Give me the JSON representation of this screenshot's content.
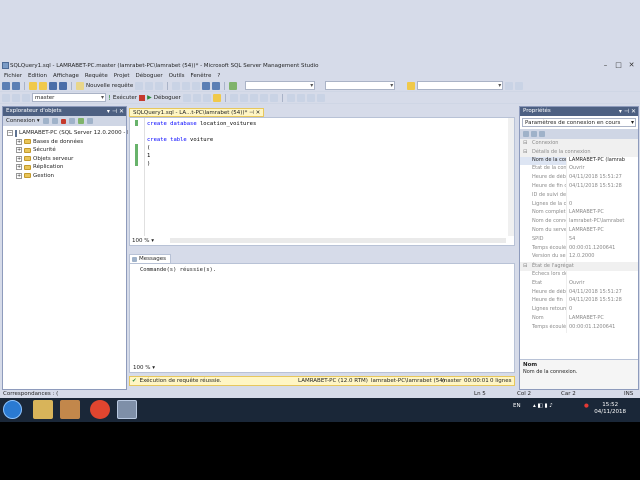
{
  "window": {
    "title": "SQLQuery1.sql - LAMRABET-PC.master (lamrabet-PC\\lamrabet (54))* - Microsoft SQL Server Management Studio"
  },
  "menu": [
    "Fichier",
    "Edition",
    "Affichage",
    "Requête",
    "Projet",
    "Déboguer",
    "Outils",
    "Fenêtre",
    "?"
  ],
  "toolbar1": {
    "new_query": "Nouvelle requête"
  },
  "toolbar2": {
    "database": "master",
    "execute": "Exécuter",
    "debug": "Déboguer"
  },
  "object_explorer": {
    "title": "Explorateur d'objets",
    "connect": "Connexion",
    "server": "LAMRABET-PC (SQL Server 12.0.2000 - la",
    "nodes": [
      "Bases de données",
      "Sécurité",
      "Objets serveur",
      "Réplication",
      "Gestion"
    ]
  },
  "document_tab": "SQLQuery1.sql - LA...t-PC\\lamrabet (54))*",
  "editor": {
    "line1_kw": "create database",
    "line1_rest": " location_voitures",
    "line3_kw": "create table",
    "line3_rest": " voiture",
    "line4": "(",
    "line5": "1",
    "line6": ")",
    "zoom": "100 %"
  },
  "results": {
    "tab": "Messages",
    "message": "Commande(s) réussie(s).",
    "zoom": "100 %"
  },
  "query_status": {
    "text": "Exécution de requête réussie.",
    "server": "LAMRABET-PC (12.0 RTM)",
    "user": "lamrabet-PC\\lamrabet (54)",
    "db": "master",
    "time": "00:00:01",
    "rows": "0 lignes"
  },
  "properties": {
    "title": "Propriétés",
    "selector": "Paramètres de connexion en cours",
    "cat1": "Connexion",
    "sub1": "Détails de la connexion",
    "rows1": [
      [
        "Nom de la connex",
        "LAMRABET-PC (lamrab"
      ],
      [
        "État de la connexi",
        "Ouvrir"
      ],
      [
        "Heure de début d",
        "04/11/2018 15:51:27"
      ],
      [
        "Heure de fin de la",
        "04/11/2018 15:51:28"
      ],
      [
        "ID de suivi de sess",
        ""
      ],
      [
        "Lignes de la conn",
        "0"
      ],
      [
        "Nom complet",
        "LAMRABET-PC"
      ],
      [
        "Nom de connexio",
        "lamrabet-PC\\lamrabet"
      ],
      [
        "Nom du serveur",
        "LAMRABET-PC"
      ],
      [
        "SPID",
        "54"
      ],
      [
        "Temps écoulé de",
        "00:00:01.1200641"
      ],
      [
        "Version du serveu",
        "12.0.2000"
      ]
    ],
    "cat2": "État de l'agrégat",
    "rows2": [
      [
        "Échecs lors de la c",
        ""
      ],
      [
        "État",
        "Ouvrir"
      ],
      [
        "Heure de début",
        "04/11/2018 15:51:27"
      ],
      [
        "Heure de fin",
        "04/11/2018 15:51:28"
      ],
      [
        "Lignes retournées",
        "0"
      ],
      [
        "Nom",
        "LAMRABET-PC"
      ],
      [
        "Temps écoulé",
        "00:00:01.1200641"
      ]
    ],
    "desc_title": "Nom",
    "desc_text": "Nom de la connexion."
  },
  "status": {
    "left": "Correspondances : (",
    "ln": "Ln 5",
    "col": "Col 2",
    "car": "Car 2",
    "ins": "INS"
  },
  "taskbar": {
    "lang": "EN",
    "time": "15:52",
    "date": "04/11/2018"
  }
}
